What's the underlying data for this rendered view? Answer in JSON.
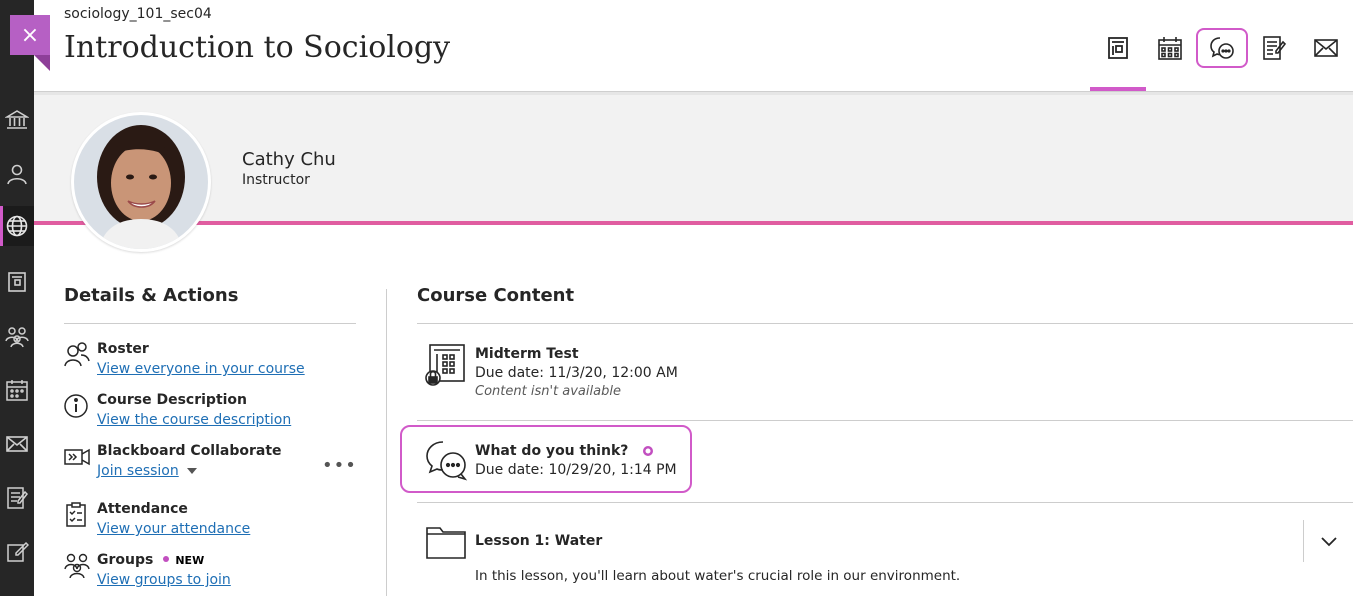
{
  "course": {
    "code": "sociology_101_sec04",
    "title": "Introduction to Sociology"
  },
  "close_button": {
    "label": "×"
  },
  "top_nav": [
    {
      "name": "content",
      "icon": "course-content-icon"
    },
    {
      "name": "calendar",
      "icon": "calendar-icon"
    },
    {
      "name": "discussions",
      "icon": "discussion-icon"
    },
    {
      "name": "gradebook",
      "icon": "gradebook-icon"
    },
    {
      "name": "messages",
      "icon": "envelope-icon"
    }
  ],
  "instructor": {
    "name": "Cathy Chu",
    "role": "Instructor"
  },
  "details": {
    "heading": "Details & Actions",
    "items": [
      {
        "title": "Roster",
        "link": "View everyone in your course"
      },
      {
        "title": "Course Description",
        "link": "View the course description"
      },
      {
        "title": "Blackboard Collaborate",
        "link": "Join session"
      },
      {
        "title": "Attendance",
        "link": "View your attendance"
      },
      {
        "title": "Groups",
        "link": "View groups to join",
        "badge": "NEW"
      }
    ],
    "more": "•••"
  },
  "content": {
    "heading": "Course Content",
    "items": [
      {
        "title": "Midterm Test",
        "due": "Due date: 11/3/20, 12:00 AM",
        "note": "Content isn't available"
      },
      {
        "title": "What do you think?",
        "due": "Due date: 10/29/20, 1:14 PM"
      },
      {
        "title": "Lesson 1: Water",
        "description": "In this lesson, you'll learn about water's crucial role in our environment."
      }
    ]
  },
  "colors": {
    "accent": "#d15ac9",
    "banner_line": "#e05da0",
    "link": "#1f6fb5",
    "rail": "#262626"
  }
}
